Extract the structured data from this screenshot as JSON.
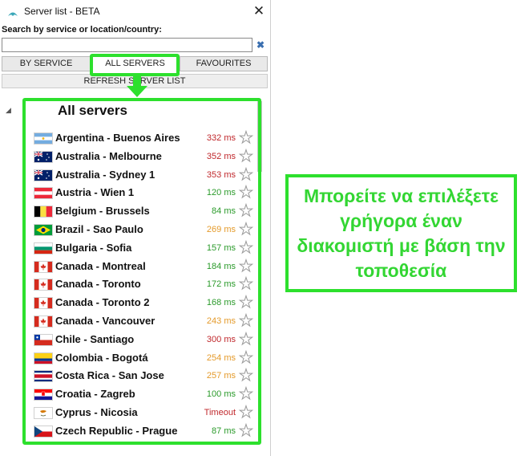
{
  "window": {
    "title": "Server list - BETA",
    "close_glyph": "✕"
  },
  "search": {
    "label": "Search by service or location/country:",
    "value": "",
    "placeholder": "",
    "clear_glyph": "✖"
  },
  "tabs": [
    {
      "label": "BY SERVICE",
      "active": false
    },
    {
      "label": "ALL SERVERS",
      "active": true
    },
    {
      "label": "FAVOURITES",
      "active": false
    }
  ],
  "refresh_label": "REFRESH SERVER LIST",
  "list": {
    "title": "All servers",
    "expand_glyph": "◢",
    "servers": [
      {
        "name": "Argentina - Buenos Aires",
        "ping": "332 ms",
        "ping_color": "#c0282c",
        "flag": "argentina-flag-icon"
      },
      {
        "name": "Australia - Melbourne",
        "ping": "352 ms",
        "ping_color": "#c0282c",
        "flag": "australia-flag-icon"
      },
      {
        "name": "Australia - Sydney 1",
        "ping": "353 ms",
        "ping_color": "#c0282c",
        "flag": "australia-flag-icon"
      },
      {
        "name": "Austria - Wien 1",
        "ping": "120 ms",
        "ping_color": "#2a9a2a",
        "flag": "austria-flag-icon"
      },
      {
        "name": "Belgium - Brussels",
        "ping": "84 ms",
        "ping_color": "#2a9a2a",
        "flag": "belgium-flag-icon"
      },
      {
        "name": "Brazil - Sao Paulo",
        "ping": "269 ms",
        "ping_color": "#e49a2a",
        "flag": "brazil-flag-icon"
      },
      {
        "name": "Bulgaria - Sofia",
        "ping": "157 ms",
        "ping_color": "#2a9a2a",
        "flag": "bulgaria-flag-icon"
      },
      {
        "name": "Canada - Montreal",
        "ping": "184 ms",
        "ping_color": "#2a9a2a",
        "flag": "canada-flag-icon"
      },
      {
        "name": "Canada - Toronto",
        "ping": "172 ms",
        "ping_color": "#2a9a2a",
        "flag": "canada-flag-icon"
      },
      {
        "name": "Canada - Toronto 2",
        "ping": "168 ms",
        "ping_color": "#2a9a2a",
        "flag": "canada-flag-icon"
      },
      {
        "name": "Canada - Vancouver",
        "ping": "243 ms",
        "ping_color": "#e49a2a",
        "flag": "canada-flag-icon"
      },
      {
        "name": "Chile - Santiago",
        "ping": "300 ms",
        "ping_color": "#c0282c",
        "flag": "chile-flag-icon"
      },
      {
        "name": "Colombia - Bogotá",
        "ping": "254 ms",
        "ping_color": "#e49a2a",
        "flag": "colombia-flag-icon"
      },
      {
        "name": "Costa Rica - San Jose",
        "ping": "257 ms",
        "ping_color": "#e49a2a",
        "flag": "costa-rica-flag-icon"
      },
      {
        "name": "Croatia - Zagreb",
        "ping": "100 ms",
        "ping_color": "#2a9a2a",
        "flag": "croatia-flag-icon"
      },
      {
        "name": "Cyprus - Nicosia",
        "ping": "Timeout",
        "ping_color": "#c0282c",
        "flag": "cyprus-flag-icon"
      },
      {
        "name": "Czech Republic - Prague",
        "ping": "87 ms",
        "ping_color": "#2a9a2a",
        "flag": "czech-flag-icon"
      }
    ],
    "favourite_glyph": "★"
  },
  "callout": {
    "text": "Μπορείτε να επιλέξετε γρήγορα έναν διακομιστή με βάση την τοποθεσία"
  },
  "colors": {
    "highlight": "#2de02d",
    "callout_text": "#33d633"
  }
}
